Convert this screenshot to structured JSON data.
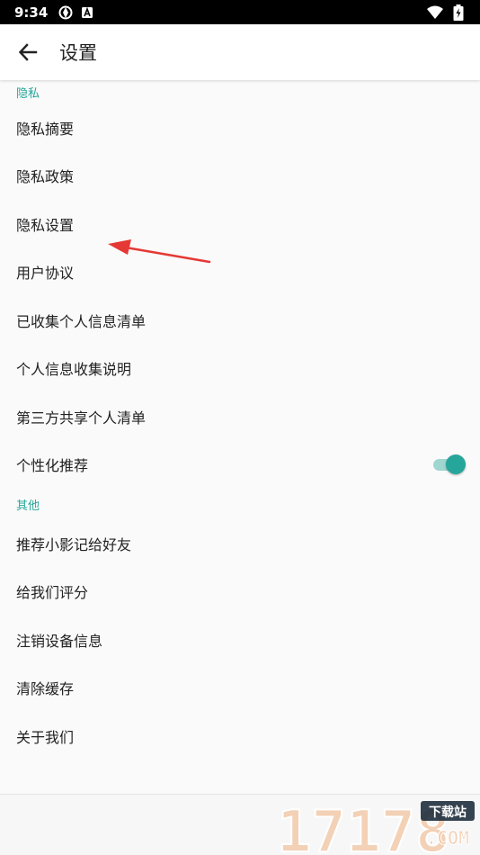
{
  "status_bar": {
    "time": "9:34"
  },
  "app_bar": {
    "title": "设置"
  },
  "sections": [
    {
      "header": "隐私",
      "items": [
        {
          "label": "隐私摘要"
        },
        {
          "label": "隐私政策"
        },
        {
          "label": "隐私设置"
        },
        {
          "label": "用户协议"
        },
        {
          "label": "已收集个人信息清单"
        },
        {
          "label": "个人信息收集说明"
        },
        {
          "label": "第三方共享个人清单"
        },
        {
          "label": "个性化推荐",
          "toggle": true
        }
      ]
    },
    {
      "header": "其他",
      "items": [
        {
          "label": "推荐小影记给好友"
        },
        {
          "label": "给我们评分"
        },
        {
          "label": "注销设备信息"
        },
        {
          "label": "清除缓存"
        },
        {
          "label": "关于我们"
        }
      ]
    }
  ],
  "colors": {
    "accent": "#26a69a",
    "toggle_track": "#9fd6d0",
    "annotation_arrow": "#e53935"
  },
  "watermark": {
    "number": "17178",
    "tag": "下载站",
    "domain": ".COM"
  }
}
